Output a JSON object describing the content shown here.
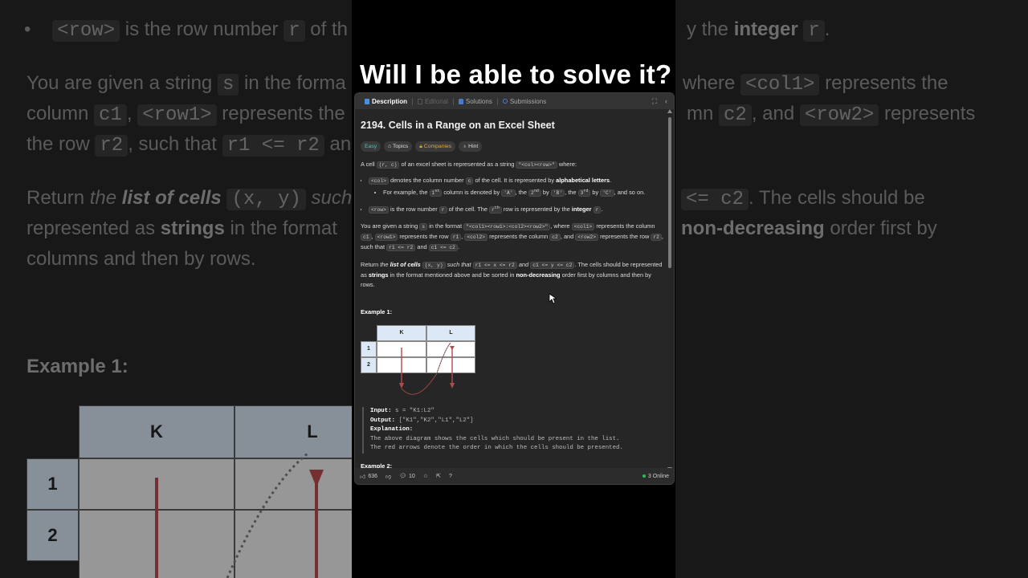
{
  "video": {
    "title": "Will I be able to solve it?"
  },
  "tabs": [
    {
      "label": "Description",
      "state": "active"
    },
    {
      "label": "Editorial",
      "state": "disabled"
    },
    {
      "label": "Solutions",
      "state": "normal"
    },
    {
      "label": "Submissions",
      "state": "normal"
    }
  ],
  "problem": {
    "title": "2194. Cells in a Range on an Excel Sheet",
    "tags": {
      "difficulty": "Easy",
      "topics": "Topics",
      "companies": "Companies",
      "hint": "Hint"
    },
    "p1": {
      "a": "A cell ",
      "code1": "(r, c)",
      "b": " of an excel sheet is represented as a string ",
      "code2": "\"<col><row>\"",
      "c": " where:"
    },
    "li1": {
      "code": "<col>",
      "a": " denotes the column number ",
      "code2": "c",
      "b": " of the cell. It is represented by ",
      "bold": "alphabetical letters",
      "c": "."
    },
    "li1sub": {
      "a": "For example, the ",
      "n1": "1",
      "s1": "st",
      "b": " column is denoted by ",
      "c1": "'A'",
      "c": ", the ",
      "n2": "2",
      "s2": "nd",
      "d": " by ",
      "c2": "'B'",
      "e": ", the ",
      "n3": "3",
      "s3": "rd",
      "f": " by ",
      "c3": "'C'",
      "g": ", and so on."
    },
    "li2": {
      "code": "<row>",
      "a": " is the row number ",
      "code2": "r",
      "b": " of the cell. The ",
      "code3": "r",
      "sup": "th",
      "c": " row is represented by the ",
      "bold": "integer",
      "d": " ",
      "code4": "r",
      "e": "."
    },
    "p2": {
      "a": "You are given a string ",
      "c1": "s",
      "b": " in the format ",
      "c2": "\"<col1><row1>:<col2><row2>\"",
      "c": ", where ",
      "c3": "<col1>",
      "d": " represents the column ",
      "c4": "c1",
      "e": ", ",
      "c5": "<row1>",
      "f": " represents the row ",
      "c6": "r1",
      "g": ", ",
      "c7": "<col2>",
      "h": " represents the column ",
      "c8": "c2",
      "i": ", and ",
      "c9": "<row2>",
      "j": " represents the row ",
      "c10": "r2",
      "k": ", such that ",
      "c11": "r1 <= r2",
      "l": " and ",
      "c12": "c1 <= c2",
      "m": "."
    },
    "p3": {
      "a": "Return ",
      "em": "the ",
      "emb": "list of cells",
      "c1": "(x, y)",
      "em2": " such that ",
      "c2": "r1 <= x <= r2",
      "em3": " and ",
      "c3": "c1 <= y <= c2",
      "b": ". The cells should be represented as ",
      "bold1": "strings",
      "c": " in the format mentioned above and be sorted in ",
      "bold2": "non-decreasing",
      "d": " order first by columns and then by rows."
    },
    "example1": {
      "title": "Example 1:",
      "cols": [
        "K",
        "L"
      ],
      "rows": [
        "1",
        "2"
      ],
      "input_label": "Input:",
      "input": " s = \"K1:L2\"",
      "output_label": "Output:",
      "output": " [\"K1\",\"K2\",\"L1\",\"L2\"]",
      "expl_label": "Explanation:",
      "expl1": "The above diagram shows the cells which should be present in the list.",
      "expl2": "The red arrows denote the order in which the cells should be presented."
    },
    "example2_title": "Example 2:"
  },
  "footer": {
    "likes": "636",
    "comments": "10",
    "online": "3 Online"
  },
  "colors": {
    "accent_easy": "#46c6c2",
    "companies": "#e9a43c",
    "online": "#2cbb5d",
    "arrow": "#b24a4a"
  },
  "background": {
    "line1": {
      "a": "•",
      "code1": "<row>",
      "b": " is the row number ",
      "code2": "r",
      "c": " of th",
      "d": "y the ",
      "bold": "integer",
      "code3": "r",
      "e": "."
    },
    "line2": {
      "a": "You are given a string ",
      "code": "s",
      "b": " in the forma",
      "c": " where ",
      "code2": "<col1>",
      "d": " represents the"
    },
    "line3": {
      "a": "column ",
      "code": "c1",
      "b": ", ",
      "code2": "<row1>",
      "c": " represents the ",
      "d": "mn ",
      "code3": "c2",
      "e": ", and ",
      "code4": "<row2>",
      "f": " represents"
    },
    "line4": {
      "a": "the row ",
      "code": "r2",
      "b": ", such that ",
      "code2": "r1 <= r2",
      "c": " an"
    },
    "line5": {
      "a": "Return ",
      "em": "the ",
      "emb": "list of cells",
      "code": "(x, y)",
      "b": " such",
      "code2": "<= c2",
      "c": ". The cells should be"
    },
    "line6": {
      "a": "represented as ",
      "bold": "strings",
      "b": " in the format",
      "bold2": "non-decreasing",
      "c": " order first by"
    },
    "line7": "columns and then by rows.",
    "example": "Example 1:",
    "cols": [
      "K",
      "L"
    ],
    "rows": [
      "1",
      "2"
    ]
  }
}
